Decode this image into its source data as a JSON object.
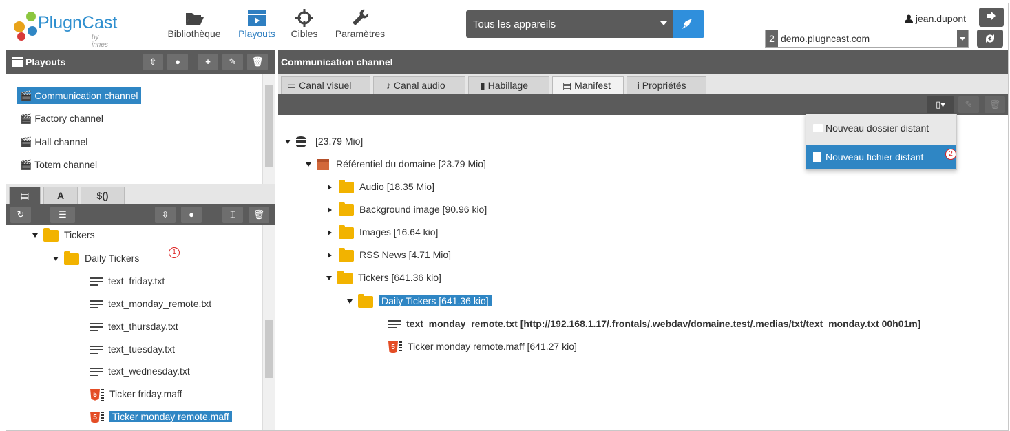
{
  "topnav": {
    "brand": "PlugnCast",
    "by": "by innes",
    "items": [
      {
        "label": "Bibliothèque",
        "icon": "folder-open-icon"
      },
      {
        "label": "Playouts",
        "icon": "film-play-icon"
      },
      {
        "label": "Cibles",
        "icon": "crosshair-icon"
      },
      {
        "label": "Paramètres",
        "icon": "wrench-icon"
      }
    ],
    "device_select": "Tous les appareils",
    "user": "jean.dupont",
    "domain_number": "2",
    "domain": "demo.plugncast.com"
  },
  "left": {
    "title": "Playouts",
    "playouts": [
      {
        "label": "Communication channel",
        "selected": true
      },
      {
        "label": "Factory channel"
      },
      {
        "label": "Hall channel"
      },
      {
        "label": "Totem channel"
      }
    ],
    "tabs": [
      {
        "label": "",
        "icon": "archive-icon"
      },
      {
        "label": "A"
      },
      {
        "label": "$()"
      }
    ],
    "tree": {
      "folder": "Tickers",
      "subfolder": "Daily Tickers",
      "files": [
        "text_friday.txt",
        "text_monday_remote.txt",
        "text_thursday.txt",
        "text_tuesday.txt",
        "text_wednesday.txt"
      ],
      "maffs": [
        "Ticker friday.maff",
        "Ticker monday remote.maff"
      ]
    },
    "callout": "1"
  },
  "right": {
    "title": "Communication channel",
    "tabs": [
      {
        "label": "Canal visuel"
      },
      {
        "label": "Canal audio"
      },
      {
        "label": "Habillage"
      },
      {
        "label": "Manifest",
        "active": true
      },
      {
        "label": "Propriétés"
      }
    ],
    "tree": {
      "root": "[23.79 Mio]",
      "domain": "Référentiel du domaine [23.79 Mio]",
      "folders": [
        "Audio [18.35 Mio]",
        "Background image [90.96 kio]",
        "Images [16.64 kio]",
        "RSS News [4.71 Mio]",
        "Tickers [641.36 kio]"
      ],
      "subfolder": "Daily Tickers [641.36 kio]",
      "remote_file": "text_monday_remote.txt [http://192.168.1.17/.frontals/.webdav/domaine.test/.medias/txt/text_monday.txt 00h01m]",
      "maff": "Ticker monday remote.maff [641.27 kio]"
    },
    "dropdown": {
      "items": [
        "Nouveau dossier distant",
        "Nouveau fichier distant"
      ],
      "callout": "2"
    }
  },
  "colors": {
    "accent": "#2f86c4",
    "toolbar": "#5b5b5b",
    "folder": "#f2b300"
  }
}
